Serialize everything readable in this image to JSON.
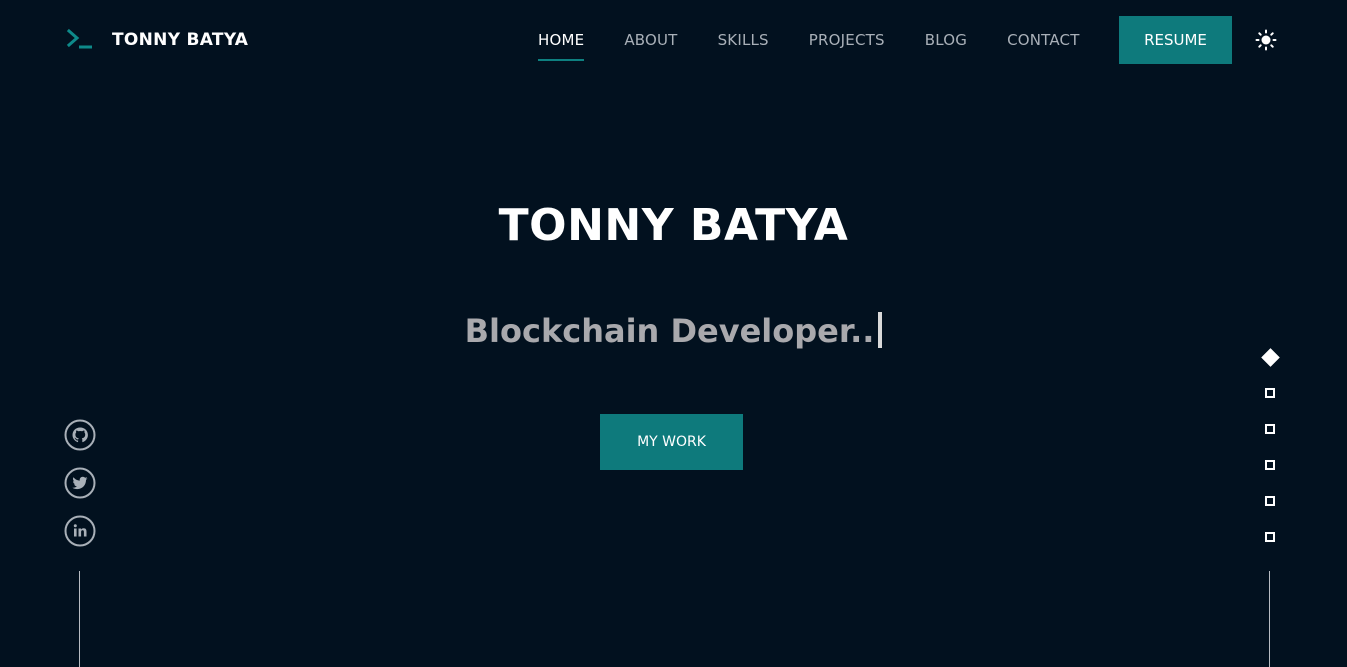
{
  "brand": {
    "name": "TONNY BATYA",
    "icon": "terminal-prompt-icon"
  },
  "nav": {
    "items": [
      {
        "label": "HOME",
        "active": true
      },
      {
        "label": "ABOUT",
        "active": false
      },
      {
        "label": "SKILLS",
        "active": false
      },
      {
        "label": "PROJECTS",
        "active": false
      },
      {
        "label": "BLOG",
        "active": false
      },
      {
        "label": "CONTACT",
        "active": false
      }
    ],
    "resume_label": "RESUME",
    "theme_icon": "sun-icon"
  },
  "hero": {
    "title": "TONNY BATYA",
    "subtitle": "Blockchain Developer..",
    "cta_label": "MY WORK"
  },
  "social": {
    "icons": [
      "github-icon",
      "twitter-icon",
      "linkedin-icon"
    ]
  },
  "section_indicators": {
    "count": 6,
    "active_index": 0
  },
  "colors": {
    "background": "#02111f",
    "accent": "#0e7a7c",
    "nav_text": "#a9b0b8",
    "subtitle_text": "#a9a9ad"
  }
}
